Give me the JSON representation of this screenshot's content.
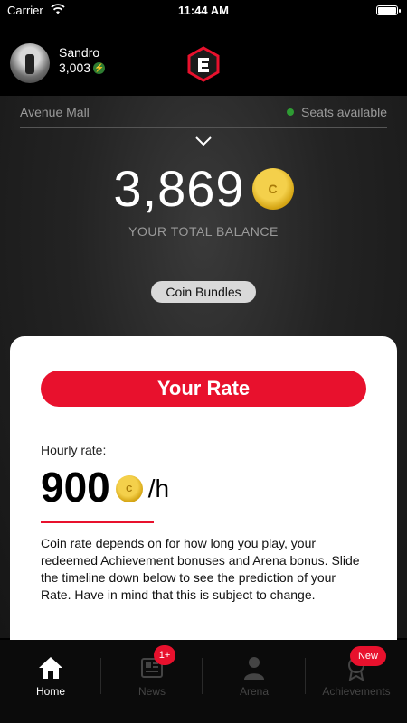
{
  "status_bar": {
    "carrier": "Carrier",
    "time": "11:44 AM"
  },
  "user": {
    "name": "Sandro",
    "coins": "3,003"
  },
  "location": {
    "venue": "Avenue Mall",
    "seats_status": "Seats available",
    "status_color": "#2e9b33"
  },
  "balance": {
    "value": "3,869",
    "label": "YOUR TOTAL BALANCE",
    "coin_symbol": "C"
  },
  "coin_bundles": {
    "label": "Coin Bundles"
  },
  "rate_card": {
    "title": "Your Rate",
    "hourly_label": "Hourly rate:",
    "rate_value": "900",
    "rate_unit": "/h",
    "coin_symbol": "C",
    "description": "Coin rate depends on for how long you play, your redeemed Achievement bonuses and Arena bonus. Slide the timeline down below to see the prediction of your Rate. Have in mind that this is subject to change."
  },
  "tabs": [
    {
      "label": "Home",
      "icon": "home-icon",
      "active": true
    },
    {
      "label": "News",
      "icon": "news-icon",
      "active": false,
      "badge": "1+"
    },
    {
      "label": "Arena",
      "icon": "arena-icon",
      "active": false
    },
    {
      "label": "Achievements",
      "icon": "achievements-icon",
      "active": false,
      "badge": "New"
    }
  ],
  "colors": {
    "accent": "#e8112d",
    "coin": "#d5a514",
    "background": "#000000"
  }
}
